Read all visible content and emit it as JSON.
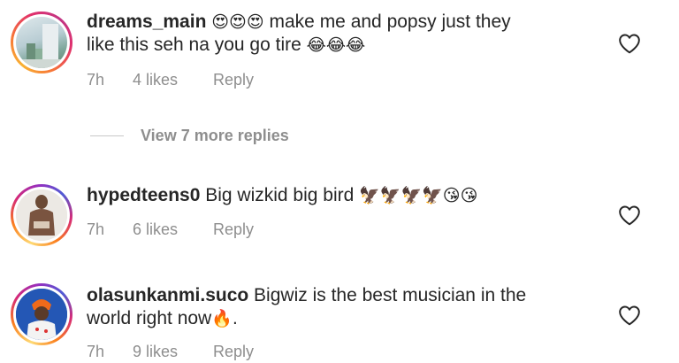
{
  "comments": [
    {
      "username": "dreams_main",
      "text_lead": "😍😍😍",
      "text_line1": " make me and popsy just they",
      "text_line2": "like this seh na you go tire ",
      "text_tail": "😂😂😂",
      "time": "7h",
      "likes": "4 likes",
      "reply": "Reply"
    },
    {
      "username": "hypedteens0",
      "text_line1": " Big wizkid big bird ",
      "text_tail": "🦅🦅🦅🦅😘😘",
      "time": "7h",
      "likes": "6 likes",
      "reply": "Reply"
    },
    {
      "username": "olasunkanmi.suco",
      "text_line1": " Bigwiz is the best musician in the",
      "text_line2": "world right now",
      "text_tail": "🔥.",
      "time": "7h",
      "likes": "9 likes",
      "reply": "Reply"
    }
  ],
  "view_more": "View 7 more replies",
  "icons": {
    "like": "heart-outline-icon"
  },
  "colors": {
    "text": "#262626",
    "meta": "#8e8e8e",
    "divider": "#c7c7c7"
  }
}
